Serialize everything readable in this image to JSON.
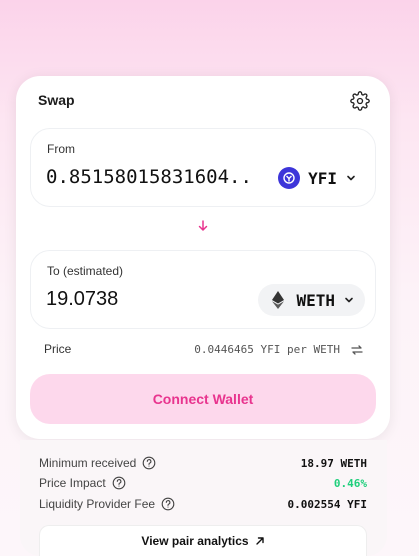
{
  "swap": {
    "title": "Swap",
    "from": {
      "label": "From",
      "amount": "0.85158015831604...",
      "token": "YFI"
    },
    "to": {
      "label": "To (estimated)",
      "amount": "19.0738",
      "token": "WETH"
    },
    "price": {
      "label": "Price",
      "value": "0.0446465 YFI per WETH"
    },
    "connect_label": "Connect Wallet"
  },
  "details": {
    "minimum_received": {
      "label": "Minimum received",
      "value": "18.97 WETH"
    },
    "price_impact": {
      "label": "Price Impact",
      "value": "0.46%"
    },
    "lp_fee": {
      "label": "Liquidity Provider Fee",
      "value": "0.002554 YFI"
    },
    "analytics_label": "View pair analytics"
  },
  "colors": {
    "accent": "#e8348e",
    "accent_bg": "#fdd8ec",
    "positive": "#1fcf7c",
    "yfi_logo": "#3d35d9"
  },
  "icons": {
    "settings": "gear-icon",
    "direction": "arrow-down-icon",
    "dropdown": "chevron-down-icon",
    "invert_price": "swap-horizontal-icon",
    "help": "question-circle-icon",
    "external": "arrow-up-right-icon"
  }
}
